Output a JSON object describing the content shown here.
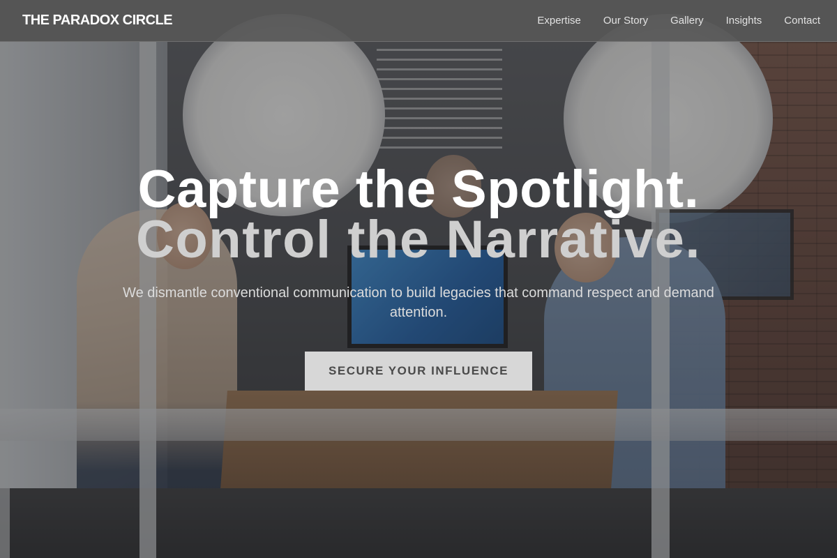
{
  "nav": {
    "brand": "THE PARADOX CIRCLE",
    "links": [
      "Expertise",
      "Our Story",
      "Gallery",
      "Insights",
      "Contact"
    ]
  },
  "hero": {
    "headline_line1": "Capture the Spotlight.",
    "headline_line2": "Control the Narrative.",
    "subheadline": "We dismantle conventional communication to build legacies that command respect and demand attention.",
    "cta_label": "SECURE YOUR INFLUENCE",
    "background": "podcast-studio-photo"
  },
  "colors": {
    "navbar_bg": "#585858",
    "headline_primary": "#ffffff",
    "headline_secondary": "#cfcfcf",
    "cta_bg": "#d7d7d7",
    "cta_text": "#4a4a4a"
  }
}
